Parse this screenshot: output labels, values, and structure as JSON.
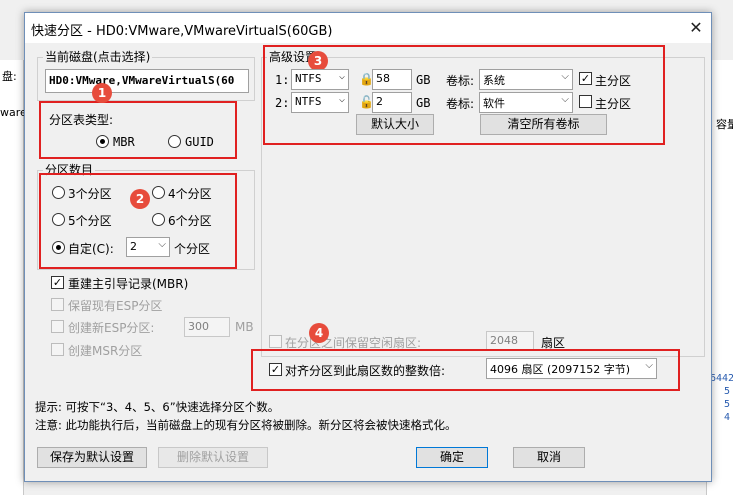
{
  "background": {
    "left_text": [
      "盘:",
      "ware"
    ],
    "right_text": [
      "容量"
    ],
    "right_numbers": [
      "6442",
      "5",
      "5",
      "4"
    ]
  },
  "dialog": {
    "title": "快速分区 - HD0:VMware,VMwareVirtualS(60GB)",
    "current_disk": {
      "label": "当前磁盘(点击选择)",
      "value": "HD0:VMware,VMwareVirtualS(60"
    },
    "partition_table": {
      "label": "分区表类型:",
      "options": [
        "MBR",
        "GUID"
      ],
      "selected": "MBR"
    },
    "partition_count": {
      "label": "分区数目",
      "options": [
        "3个分区",
        "4个分区",
        "5个分区",
        "6个分区"
      ],
      "custom_label": "自定(C):",
      "custom_value": "2",
      "custom_suffix": "个分区",
      "selected": "custom"
    },
    "options": {
      "rebuild_mbr": "重建主引导记录(MBR)",
      "keep_esp": "保留现有ESP分区",
      "create_esp": "创建新ESP分区:",
      "create_esp_value": "300",
      "create_esp_unit": "MB",
      "create_msr": "创建MSR分区"
    },
    "advanced": {
      "label": "高级设置",
      "rows": [
        {
          "index": "1:",
          "fs": "NTFS",
          "size": "58",
          "unit": "GB",
          "vol_label_title": "卷标:",
          "vol_label": "系统",
          "primary_label": "主分区",
          "primary_checked": true,
          "locked": true
        },
        {
          "index": "2:",
          "fs": "NTFS",
          "size": "2",
          "unit": "GB",
          "vol_label_title": "卷标:",
          "vol_label": "软件",
          "primary_label": "主分区",
          "primary_checked": false,
          "locked": false
        }
      ],
      "default_size_btn": "默认大小",
      "clear_labels_btn": "清空所有卷标"
    },
    "free_sectors": {
      "label": "在分区之间保留空闲扇区:",
      "value": "2048",
      "unit": "扇区"
    },
    "align": {
      "label": "对齐分区到此扇区数的整数倍:",
      "value": "4096 扇区 (2097152 字节)"
    },
    "tips": [
      "提示: 可按下“3、4、5、6”快速选择分区个数。",
      "注意: 此功能执行后，当前磁盘上的现有分区将被删除。新分区将会被快速格式化。"
    ],
    "buttons": {
      "save_default": "保存为默认设置",
      "delete_default": "删除默认设置",
      "ok": "确定",
      "cancel": "取消"
    }
  },
  "annotations": [
    "1",
    "2",
    "3",
    "4"
  ],
  "colors": {
    "highlight": "#e02020",
    "badge": "#e74c3c",
    "accent": "#0078d7"
  }
}
